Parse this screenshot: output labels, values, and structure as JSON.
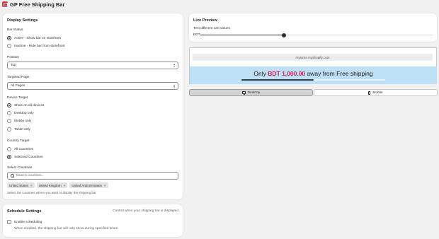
{
  "app": {
    "title": "GP Free Shipping Bar"
  },
  "display": {
    "title": "Display Settings",
    "bar_status": {
      "label": "Bar Status",
      "options": [
        "Active - Show bar on storefront",
        "Inactive - Hide bar from storefront"
      ],
      "selected": 0
    },
    "position": {
      "label": "Position",
      "value": "Top"
    },
    "targeted_page": {
      "label": "Targeted Page",
      "value": "All Pages"
    },
    "device_target": {
      "label": "Device Target",
      "options": [
        "Show on all devices",
        "Desktop only",
        "Mobile only",
        "Tablet only"
      ],
      "selected": 0
    },
    "country_target": {
      "label": "Country Target",
      "options": [
        "All Countries",
        "Selected Countries"
      ],
      "selected": 1
    },
    "select_countries": {
      "label": "Select Countries",
      "placeholder": "Search countries...",
      "tags": [
        "United States",
        "United Kingdom",
        "United Arab Emirates"
      ],
      "help": "Select the countries where you want to display the shipping bar"
    }
  },
  "schedule": {
    "title": "Schedule Settings",
    "subtitle": "Control when your shipping bar is displayed",
    "enable_label": "Enable scheduling",
    "help": "When enabled, the shipping bar will only show during specified times"
  },
  "preview": {
    "title": "Live Preview",
    "test_label": "Test different cart values",
    "currency": "BDT",
    "slider_fraction": 0.36,
    "url": "mystore.myshopify.com",
    "msg_prefix": "Only ",
    "msg_amount": "BDT 1,000.00",
    "msg_suffix": " away from Free shipping",
    "progress_fraction": 0.5,
    "bar_color": "#bde0f5",
    "amount_color": "#e0195c",
    "desktop_label": "Desktop",
    "mobile_label": "Mobile",
    "active_view": "Desktop"
  }
}
